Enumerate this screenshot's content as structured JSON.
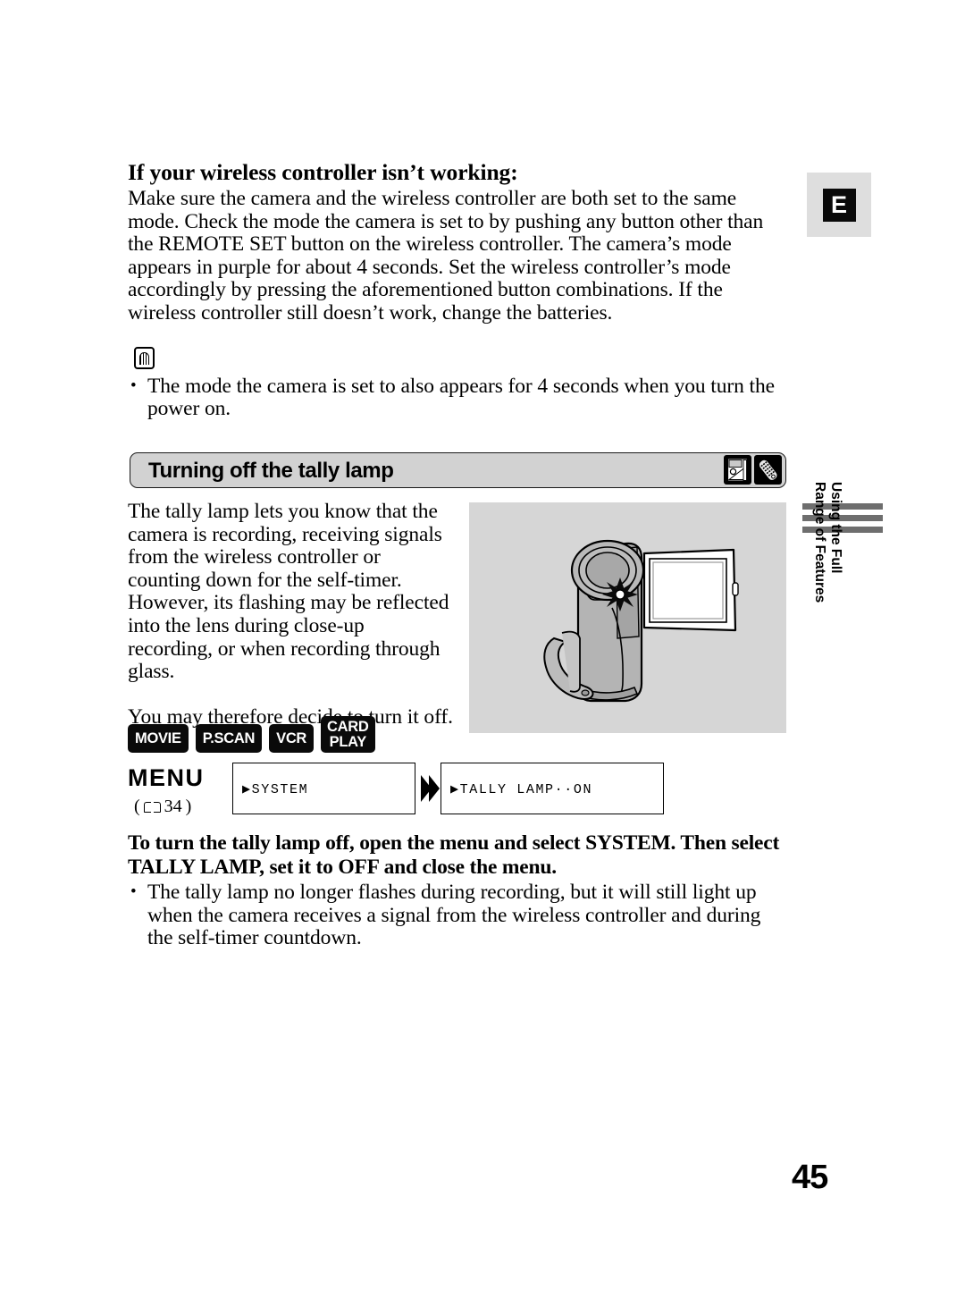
{
  "page": {
    "number": "45",
    "language_tab": "E"
  },
  "section_wireless": {
    "heading": "If your wireless controller isn’t working:",
    "body": "Make sure the camera and the wireless controller are both set to the same mode. Check the mode the camera is set to by pushing any button other than the REMOTE SET button on the wireless controller. The camera’s mode appears in purple for about 4 seconds. Set the wireless controller’s mode accordingly by pressing the aforementioned button combinations. If the wireless controller still doesn’t work, change the batteries.",
    "note_icon": "memo-icon",
    "notes": [
      "The mode the camera is set to also appears for 4 seconds when you turn the power on."
    ]
  },
  "section_tally": {
    "bar_title": "Turning off the tally lamp",
    "bar_icons": [
      "card-camera-icon",
      "wireless-controller-icon"
    ],
    "body_paragraph_1": "The tally lamp lets you know that the camera is recording, receiving signals from the wireless controller or counting down for the self-timer. However, its flashing may be reflected into the lens during close-up recording, or when recording through glass.",
    "body_paragraph_2": "You may therefore decide to turn it off.",
    "illustration": "camcorder-with-open-lcd-and-tally-lamp-starburst",
    "mode_badges": [
      {
        "name": "movie",
        "lines": [
          "MOVIE"
        ]
      },
      {
        "name": "pscan",
        "lines": [
          "P.SCAN"
        ]
      },
      {
        "name": "vcr",
        "lines": [
          "VCR"
        ]
      },
      {
        "name": "card-play",
        "lines": [
          "CARD",
          "PLAY"
        ]
      }
    ],
    "menu": {
      "label": "MENU",
      "reference_icon": "book-icon",
      "reference_page": "34",
      "box_1": "▶SYSTEM",
      "arrow_icon": "double-chevron-right-icon",
      "box_2": "▶TALLY LAMP··ON"
    },
    "instruction": "To turn the tally lamp off, open the menu and select SYSTEM. Then select TALLY LAMP, set it to OFF and close the menu.",
    "instruction_notes": [
      "The tally lamp no longer flashes during recording, but it will still light up when the camera receives a signal from the wireless controller and during the self-timer countdown."
    ]
  },
  "running_head": {
    "line1": "Using the Full",
    "line2": "Range of Features",
    "rule_count": 3
  },
  "colors": {
    "bar_background": "#d2d2d2",
    "illustration_background": "#d6d6d6",
    "tab_background": "#dedede",
    "rule_gray": "#6e6e6e",
    "ink": "#000000"
  }
}
